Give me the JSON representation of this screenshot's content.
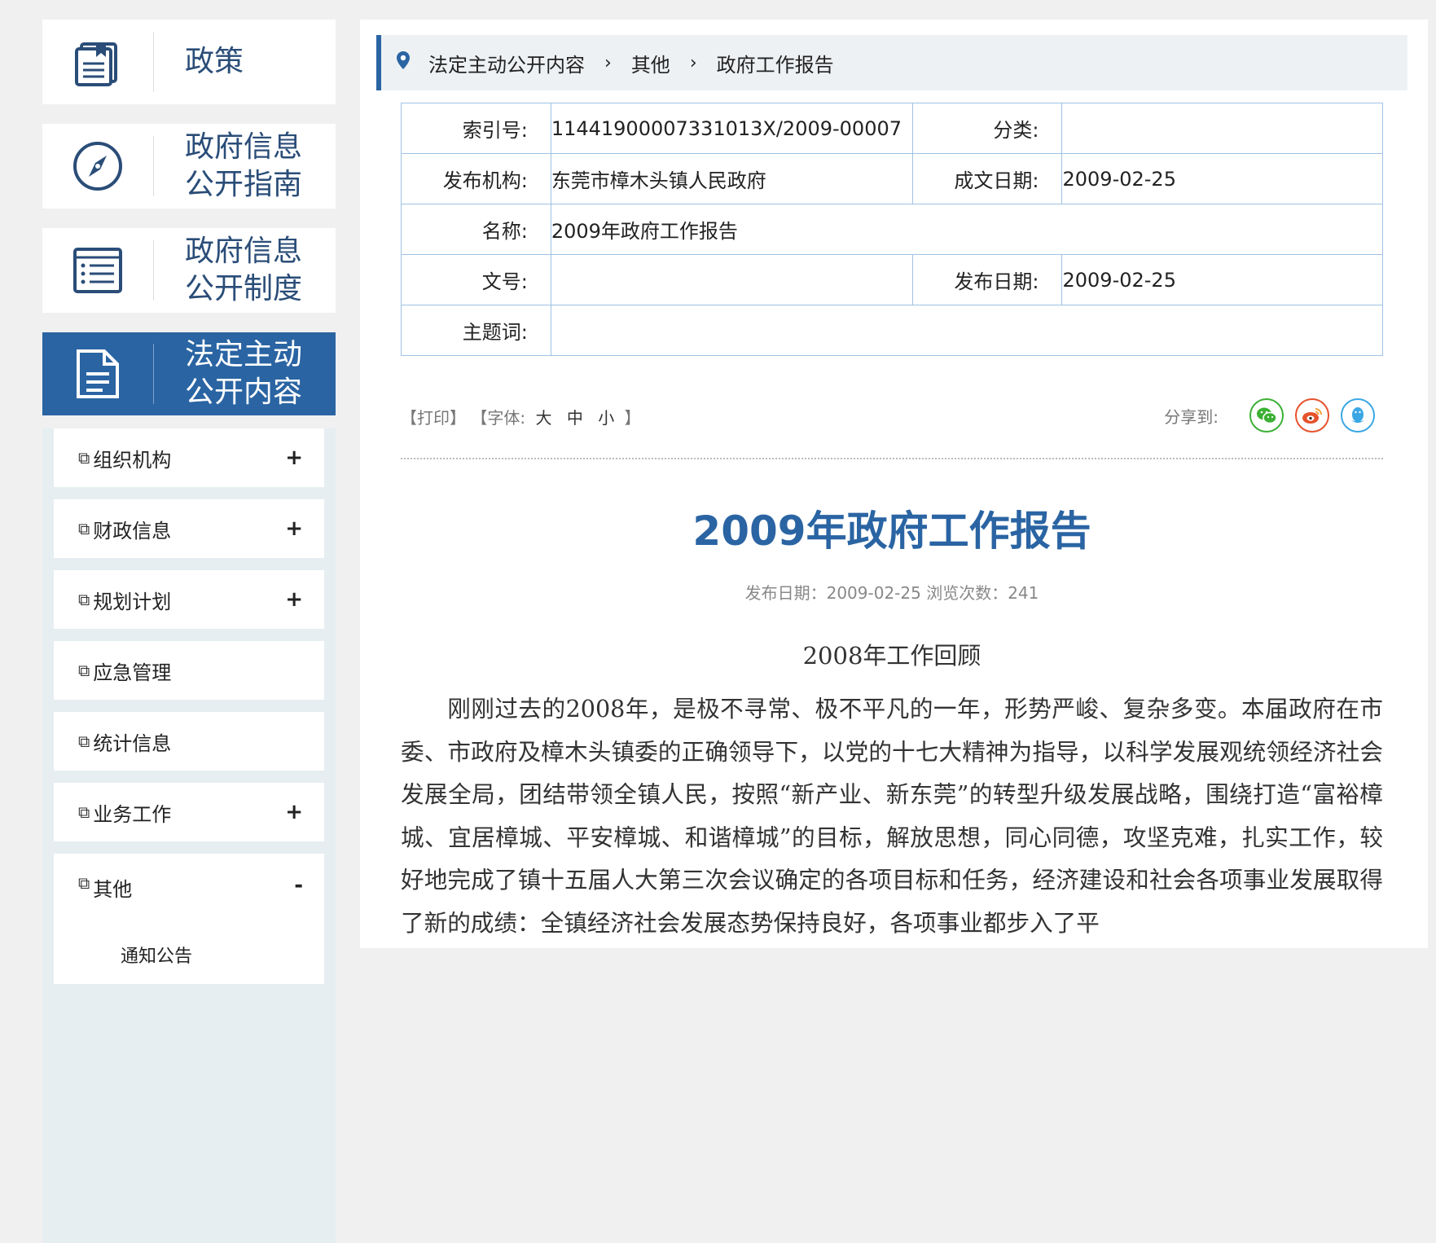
{
  "sidebar": {
    "cards": [
      {
        "label": "政策",
        "icon": "book-icon"
      },
      {
        "label": "政府信息\n公开指南",
        "icon": "compass-icon"
      },
      {
        "label": "政府信息\n公开制度",
        "icon": "list-icon"
      },
      {
        "label": "法定主动\n公开内容",
        "icon": "document-icon",
        "active": true
      }
    ],
    "items": [
      {
        "label": "组织机构",
        "toggle": "+"
      },
      {
        "label": "财政信息",
        "toggle": "+"
      },
      {
        "label": "规划计划",
        "toggle": "+"
      },
      {
        "label": "应急管理",
        "toggle": ""
      },
      {
        "label": "统计信息",
        "toggle": ""
      },
      {
        "label": "业务工作",
        "toggle": "+"
      },
      {
        "label": "其他",
        "toggle": "-",
        "child": "通知公告"
      }
    ]
  },
  "breadcrumb": [
    "法定主动公开内容",
    "其他",
    "政府工作报告"
  ],
  "meta": {
    "index_label": "索引号:",
    "index_value": "11441900007331013X/2009-00007",
    "category_label": "分类:",
    "category_value": "",
    "publisher_label": "发布机构:",
    "publisher_value": "东莞市樟木头镇人民政府",
    "written_label": "成文日期:",
    "written_value": "2009-02-25",
    "name_label": "名称:",
    "name_value": "2009年政府工作报告",
    "docno_label": "文号:",
    "docno_value": "",
    "pubdate_label": "发布日期:",
    "pubdate_value": "2009-02-25",
    "subject_label": "主题词:",
    "subject_value": ""
  },
  "tools": {
    "print": "【打印】",
    "font_prefix": "【字体:",
    "large": "大",
    "medium": "中",
    "small": "小",
    "font_suffix": "】",
    "share_label": "分享到:"
  },
  "share_colors": {
    "wechat": "#3cb034",
    "weibo": "#e6522c",
    "qq": "#3aa7e4"
  },
  "article": {
    "title": "2009年政府工作报告",
    "info": "发布日期：2009-02-25  浏览次数：241",
    "section": "2008年工作回顾",
    "body": "刚刚过去的2008年，是极不寻常、极不平凡的一年，形势严峻、复杂多变。本届政府在市委、市政府及樟木头镇委的正确领导下，以党的十七大精神为指导，以科学发展观统领经济社会发展全局，团结带领全镇人民，按照“新产业、新东莞”的转型升级发展战略，围绕打造“富裕樟城、宜居樟城、平安樟城、和谐樟城”的目标，解放思想，同心同德，攻坚克难，扎实工作，较好地完成了镇十五届人大第三次会议确定的各项目标和任务，经济建设和社会各项事业发展取得了新的成绩：全镇经济社会发展态势保持良好，各项事业都步入了平"
  }
}
